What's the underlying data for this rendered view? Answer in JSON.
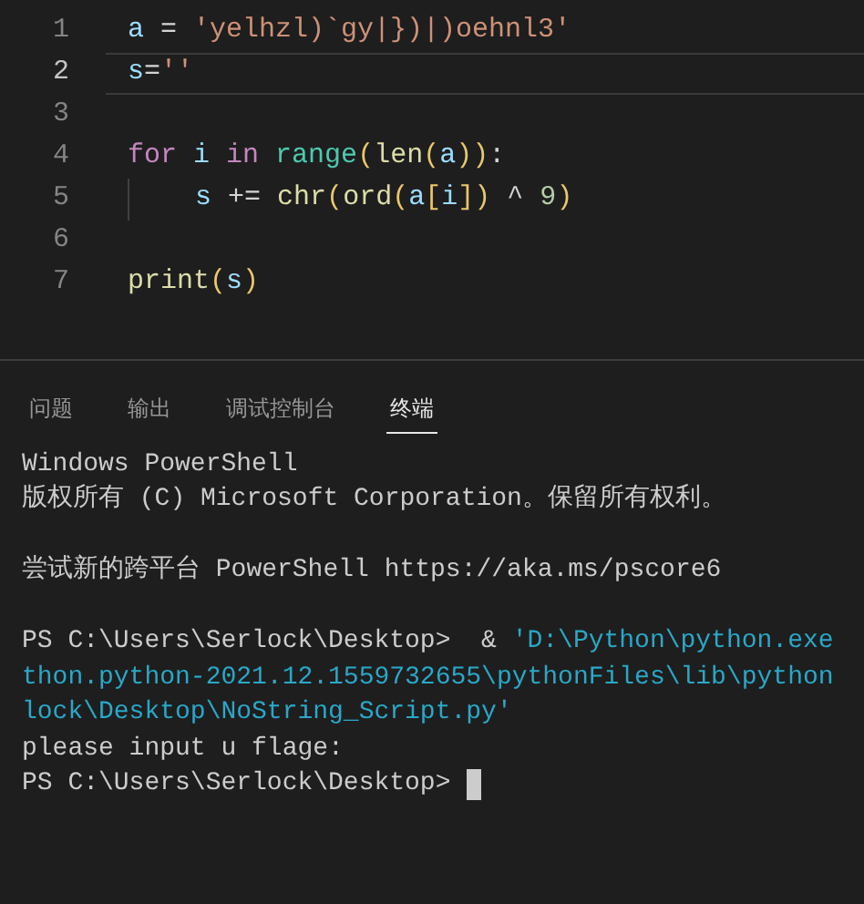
{
  "editor": {
    "lines": [
      {
        "number": "1",
        "active": false,
        "indented": false,
        "tokens": [
          {
            "kind": "var",
            "text": "a"
          },
          {
            "kind": "op",
            "text": " = "
          },
          {
            "kind": "str",
            "text": "'yelhzl)`gy|})|)oehnl3'"
          }
        ]
      },
      {
        "number": "2",
        "active": true,
        "indented": false,
        "tokens": [
          {
            "kind": "var",
            "text": "s"
          },
          {
            "kind": "op",
            "text": "="
          },
          {
            "kind": "str",
            "text": "''"
          }
        ]
      },
      {
        "number": "3",
        "active": false,
        "indented": false
      },
      {
        "number": "4",
        "active": false,
        "indented": false,
        "tokens": [
          {
            "kind": "keyword",
            "text": "for "
          },
          {
            "kind": "var",
            "text": "i "
          },
          {
            "kind": "keyword",
            "text": "in "
          },
          {
            "kind": "class",
            "text": "range"
          },
          {
            "kind": "bracket",
            "text": "("
          },
          {
            "kind": "func",
            "text": "len"
          },
          {
            "kind": "bracket",
            "text": "("
          },
          {
            "kind": "var",
            "text": "a"
          },
          {
            "kind": "bracket",
            "text": "))"
          },
          {
            "kind": "op",
            "text": ":"
          }
        ]
      },
      {
        "number": "5",
        "active": false,
        "indented": true,
        "tokens": [
          {
            "kind": "var",
            "text": "s"
          },
          {
            "kind": "op",
            "text": " += "
          },
          {
            "kind": "func",
            "text": "chr"
          },
          {
            "kind": "bracket",
            "text": "("
          },
          {
            "kind": "func",
            "text": "ord"
          },
          {
            "kind": "bracket",
            "text": "("
          },
          {
            "kind": "var",
            "text": "a"
          },
          {
            "kind": "bracket",
            "text": "["
          },
          {
            "kind": "var",
            "text": "i"
          },
          {
            "kind": "bracket",
            "text": "])"
          },
          {
            "kind": "op",
            "text": " ^ "
          },
          {
            "kind": "num",
            "text": "9"
          },
          {
            "kind": "bracket",
            "text": ")"
          }
        ]
      },
      {
        "number": "6",
        "active": false,
        "indented": false
      },
      {
        "number": "7",
        "active": false,
        "indented": false,
        "tokens": [
          {
            "kind": "func",
            "text": "print"
          },
          {
            "kind": "bracket",
            "text": "("
          },
          {
            "kind": "var",
            "text": "s"
          },
          {
            "kind": "bracket",
            "text": ")"
          }
        ]
      }
    ]
  },
  "panel": {
    "tabs": [
      {
        "label": "问题",
        "selected": false
      },
      {
        "label": "输出",
        "selected": false
      },
      {
        "label": "调试控制台",
        "selected": false
      },
      {
        "label": "终端",
        "selected": true
      }
    ],
    "terminal": {
      "lines": [
        {
          "gap_before": false,
          "segments": [
            {
              "kind": "plain",
              "text": "Windows PowerShell"
            }
          ]
        },
        {
          "gap_before": false,
          "segments": [
            {
              "kind": "plain",
              "text": "版权所有 (C) Microsoft Corporation。保留所有权利。"
            }
          ]
        },
        {
          "gap_before": true,
          "segments": [
            {
              "kind": "plain",
              "text": "尝试新的跨平台 PowerShell https://aka.ms/pscore6"
            }
          ]
        },
        {
          "gap_before": true,
          "segments": [
            {
              "kind": "plain",
              "text": "PS C:\\Users\\Serlock\\Desktop>  & "
            },
            {
              "kind": "path",
              "text": "'D:\\Python\\python.exe"
            }
          ]
        },
        {
          "gap_before": false,
          "segments": [
            {
              "kind": "path",
              "text": "thon.python-2021.12.1559732655\\pythonFiles\\lib\\python"
            }
          ]
        },
        {
          "gap_before": false,
          "segments": [
            {
              "kind": "path",
              "text": "lock\\Desktop\\NoString_Script.py'"
            }
          ]
        },
        {
          "gap_before": false,
          "segments": [
            {
              "kind": "plain",
              "text": "please input u flage:"
            }
          ]
        },
        {
          "gap_before": false,
          "segments": [
            {
              "kind": "plain",
              "text": "PS C:\\Users\\Serlock\\Desktop> "
            },
            {
              "kind": "cursor"
            }
          ]
        }
      ]
    }
  }
}
